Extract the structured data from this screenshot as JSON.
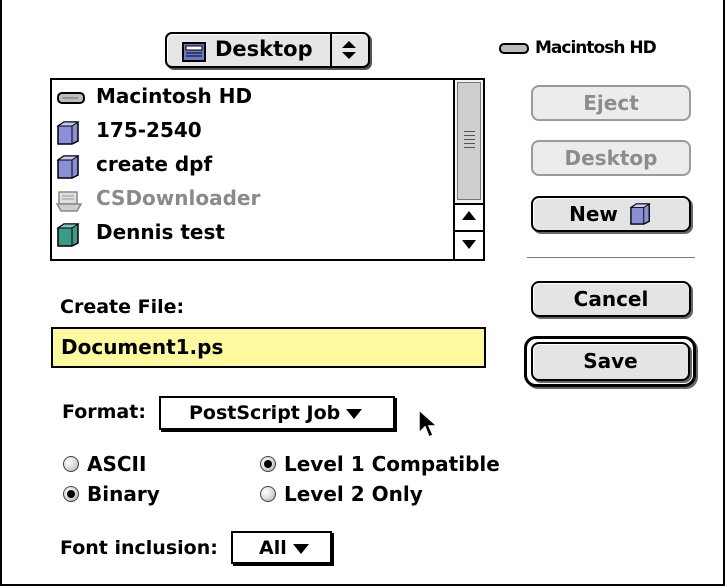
{
  "location": {
    "current_folder": "Desktop",
    "icon": "desktop-folder-icon"
  },
  "volume": {
    "name": "Macintosh HD",
    "icon": "hard-drive-icon"
  },
  "file_list": {
    "items": [
      {
        "name": "Macintosh HD",
        "icon": "hard-drive-icon",
        "dimmed": false
      },
      {
        "name": "175-2540",
        "icon": "folder-icon",
        "dimmed": false
      },
      {
        "name": "create dpf",
        "icon": "folder-icon",
        "dimmed": false
      },
      {
        "name": "CSDownloader",
        "icon": "application-icon",
        "dimmed": true
      },
      {
        "name": "Dennis test",
        "icon": "folder-icon",
        "dimmed": false
      }
    ]
  },
  "buttons": {
    "eject": "Eject",
    "desktop": "Desktop",
    "new_folder": "New",
    "cancel": "Cancel",
    "save": "Save"
  },
  "create_file": {
    "label": "Create File:",
    "value": "Document1.ps"
  },
  "format": {
    "label": "Format:",
    "selected": "PostScript Job"
  },
  "encoding": {
    "options": [
      {
        "label": "ASCII",
        "selected": false
      },
      {
        "label": "Binary",
        "selected": true
      }
    ]
  },
  "level": {
    "options": [
      {
        "label": "Level 1 Compatible",
        "selected": true
      },
      {
        "label": "Level 2 Only",
        "selected": false
      }
    ]
  },
  "font_inclusion": {
    "label": "Font inclusion:",
    "selected": "All"
  },
  "colors": {
    "field_bg": "#fdf99e",
    "folder_blue": "#8a8fd8",
    "folder_teal": "#3c9a86"
  }
}
